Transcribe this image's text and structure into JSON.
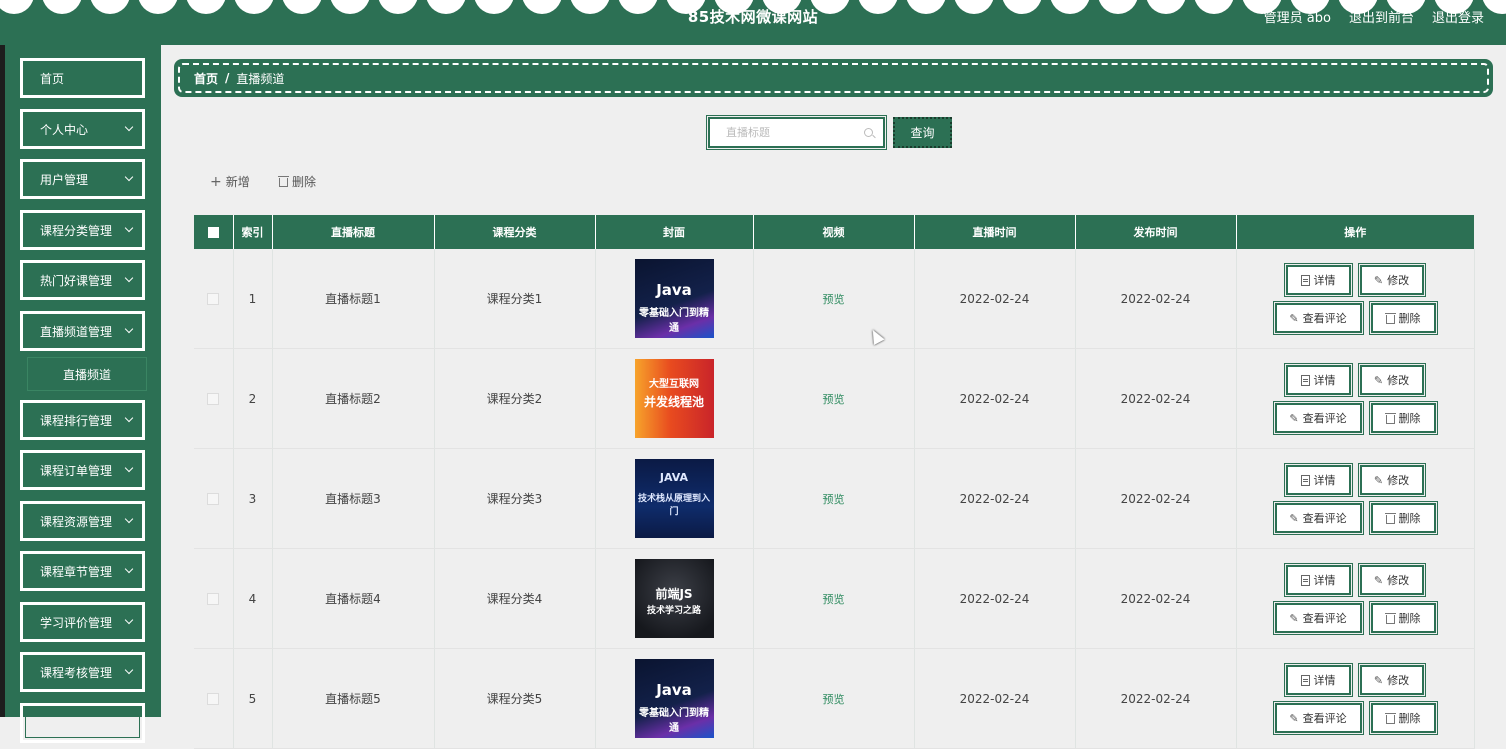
{
  "header": {
    "title": "85技术网微课网站",
    "admin_label": "管理员 abo",
    "front_link": "退出到前台",
    "logout_link": "退出登录"
  },
  "sidebar": {
    "items": [
      {
        "label": "首页",
        "expandable": false
      },
      {
        "label": "个人中心",
        "expandable": true
      },
      {
        "label": "用户管理",
        "expandable": true
      },
      {
        "label": "课程分类管理",
        "expandable": true
      },
      {
        "label": "热门好课管理",
        "expandable": true
      },
      {
        "label": "直播频道管理",
        "expandable": true
      },
      {
        "label": "课程排行管理",
        "expandable": true
      },
      {
        "label": "课程订单管理",
        "expandable": true
      },
      {
        "label": "课程资源管理",
        "expandable": true
      },
      {
        "label": "课程章节管理",
        "expandable": true
      },
      {
        "label": "学习评价管理",
        "expandable": true
      },
      {
        "label": "课程考核管理",
        "expandable": true
      }
    ],
    "submenu": {
      "label": "直播频道"
    }
  },
  "breadcrumb": {
    "home": "首页",
    "separator": "/",
    "current": "直播频道"
  },
  "search": {
    "placeholder": "直播标题",
    "button_label": "查询"
  },
  "toolbar": {
    "add_label": "新增",
    "delete_label": "删除"
  },
  "table": {
    "columns": [
      "索引",
      "直播标题",
      "课程分类",
      "封面",
      "视频",
      "直播时间",
      "发布时间",
      "操作"
    ],
    "rows": [
      {
        "index": "1",
        "title": "直播标题1",
        "category": "课程分类1",
        "video": "预览",
        "live_time": "2022-02-24",
        "publish_time": "2022-02-24",
        "cover": {
          "title": "Java",
          "subtitle": "零基础入门到精通"
        }
      },
      {
        "index": "2",
        "title": "直播标题2",
        "category": "课程分类2",
        "video": "预览",
        "live_time": "2022-02-24",
        "publish_time": "2022-02-24",
        "cover": {
          "title": "并发线程池",
          "subtitle": "大型互联网"
        }
      },
      {
        "index": "3",
        "title": "直播标题3",
        "category": "课程分类3",
        "video": "预览",
        "live_time": "2022-02-24",
        "publish_time": "2022-02-24",
        "cover": {
          "title": "JAVA",
          "subtitle": "技术栈从原理到入门"
        }
      },
      {
        "index": "4",
        "title": "直播标题4",
        "category": "课程分类4",
        "video": "预览",
        "live_time": "2022-02-24",
        "publish_time": "2022-02-24",
        "cover": {
          "title": "前端JS",
          "subtitle": "技术学习之路"
        }
      },
      {
        "index": "5",
        "title": "直播标题5",
        "category": "课程分类5",
        "video": "预览",
        "live_time": "2022-02-24",
        "publish_time": "2022-02-24",
        "cover": {
          "title": "Java",
          "subtitle": "零基础入门到精通"
        }
      }
    ],
    "actions": {
      "detail": "详情",
      "edit": "修改",
      "comments": "查看评论",
      "delete": "删除"
    }
  },
  "colors": {
    "primary": "#2c7054",
    "background": "#efefef",
    "link": "#2c8a5e"
  }
}
